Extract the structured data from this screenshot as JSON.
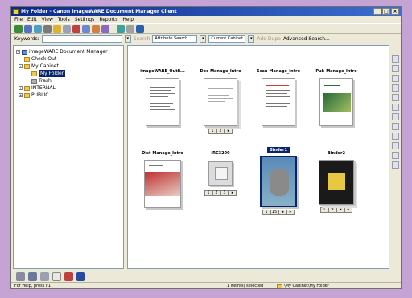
{
  "window": {
    "title": "My Folder - Canon imageWARE Document Manager Client",
    "buttons": {
      "minimize": "_",
      "maximize": "□",
      "close": "×"
    }
  },
  "menu": [
    "File",
    "Edit",
    "View",
    "Tools",
    "Settings",
    "Reports",
    "Help"
  ],
  "search_bar": {
    "keywords_label": "Keywords:",
    "keywords_value": "",
    "search_button": "Search",
    "search_type": "Attribute Search",
    "scope": "Current Cabinet",
    "add_button": "Add Dupe",
    "advanced_search": "Advanced Search..."
  },
  "tree": {
    "root": "imageWARE Document Manager",
    "check_out": "Check Out",
    "my_cabinet": "My Cabinet",
    "my_folder": "My Folder",
    "trash": "Trash",
    "internal": "INTERNAL",
    "public": "PUBLIC"
  },
  "documents": [
    {
      "name": "imageWARE_Outli...",
      "pager": []
    },
    {
      "name": "Doc-Manage_Intro",
      "pager": [
        "1",
        "2",
        "▸"
      ]
    },
    {
      "name": "Scan-Manage_Intro",
      "pager": []
    },
    {
      "name": "Pub-Manage_Intro",
      "pager": []
    },
    {
      "name": "Dist-Manage_Intro",
      "pager": []
    },
    {
      "name": "iRC3200",
      "pager": [
        "1",
        "2",
        "3",
        "▸"
      ]
    },
    {
      "name": "Binder1",
      "pager": [
        "1",
        "15",
        "◂",
        "▸"
      ]
    },
    {
      "name": "Binder2",
      "pager": [
        "1",
        "9",
        "◂",
        "▸"
      ]
    }
  ],
  "status": {
    "help": "For Help, press F1",
    "selected": "1 item(s) selected",
    "path": "\\My Cabinet\\My Folder"
  }
}
